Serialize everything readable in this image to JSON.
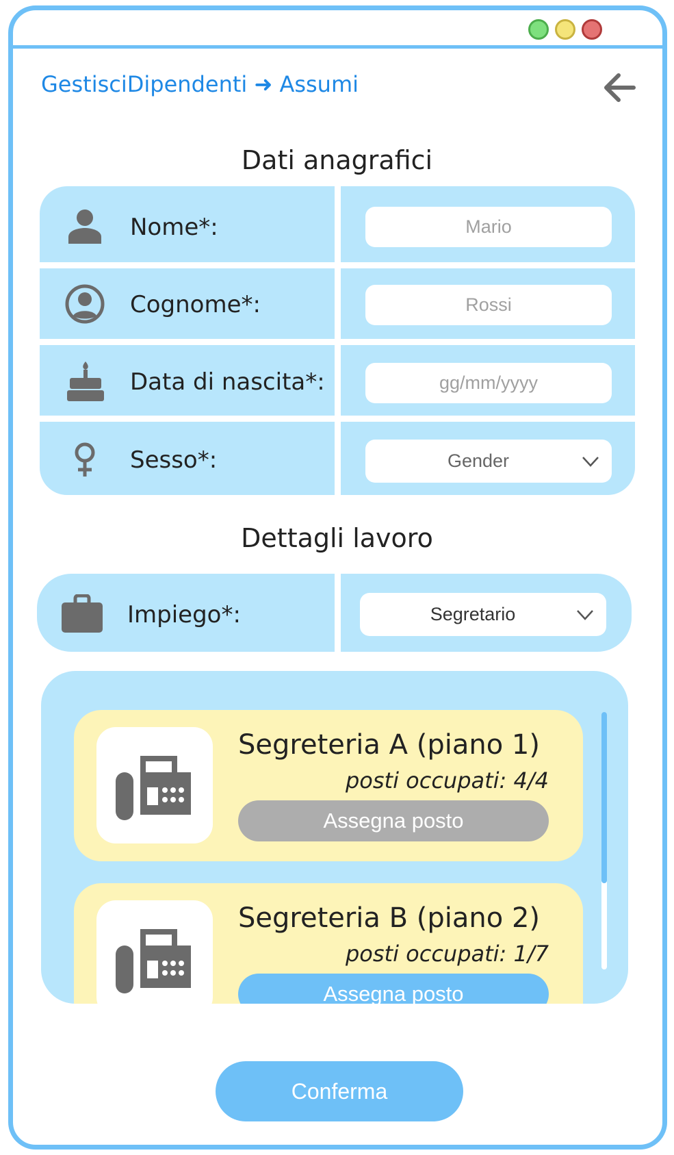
{
  "window": {
    "controls": [
      {
        "name": "maximize",
        "color": "#7ee07e"
      },
      {
        "name": "minimize",
        "color": "#f5e57a"
      },
      {
        "name": "close",
        "color": "#e57373"
      }
    ]
  },
  "breadcrumb": {
    "parent": "GestisciDipendenti",
    "separator": "➜",
    "current": "Assumi"
  },
  "back_icon": "arrow-left-icon",
  "personal": {
    "title": "Dati anagrafici",
    "nome": {
      "label": "Nome*:",
      "placeholder": "Mario"
    },
    "cognome": {
      "label": "Cognome*:",
      "placeholder": "Rossi"
    },
    "nascita": {
      "label": "Data di nascita*:",
      "placeholder": "gg/mm/yyyy"
    },
    "sesso": {
      "label": "Sesso*:",
      "value": "Gender"
    }
  },
  "job": {
    "title": "Dettagli lavoro",
    "impiego": {
      "label": "Impiego*:",
      "value": "Segretario"
    }
  },
  "offices": [
    {
      "name": "Segreteria A (piano 1)",
      "occupancy": "posti occupati: 4/4",
      "button": "Assegna posto",
      "button_state": "disabled",
      "icon": "fax-icon"
    },
    {
      "name": "Segreteria B (piano 2)",
      "occupancy": "posti occupati: 1/7",
      "button": "Assegna posto",
      "button_state": "enabled",
      "icon": "fax-icon"
    }
  ],
  "confirm_label": "Conferma",
  "colors": {
    "accent": "#6ec0f7",
    "panel": "#b8e6fc",
    "card": "#fdf4b8",
    "link": "#1e88e5",
    "disabled": "#adadad"
  }
}
